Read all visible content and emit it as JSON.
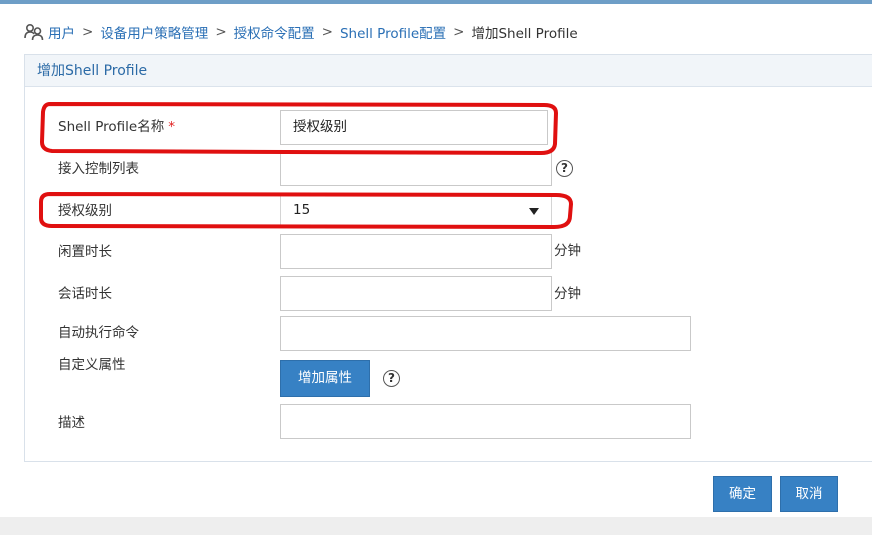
{
  "breadcrumb": {
    "items": [
      "用户",
      "设备用户策略管理",
      "授权命令配置",
      "Shell Profile配置"
    ],
    "current": "增加Shell Profile",
    "separator": ">"
  },
  "panel": {
    "title": "增加Shell Profile"
  },
  "form": {
    "profile_name": {
      "label": "Shell Profile名称",
      "required_mark": "*",
      "value": "授权级别"
    },
    "access_control_list": {
      "label": "接入控制列表",
      "value": "",
      "help": "?"
    },
    "auth_level": {
      "label": "授权级别",
      "value": "15"
    },
    "idle_time": {
      "label": "闲置时长",
      "value": "",
      "unit": "分钟"
    },
    "session_time": {
      "label": "会话时长",
      "value": "",
      "unit": "分钟"
    },
    "auto_command": {
      "label": "自动执行命令",
      "value": ""
    },
    "custom_attr": {
      "label": "自定义属性",
      "add_button": "增加属性",
      "help": "?"
    },
    "description": {
      "label": "描述",
      "value": ""
    }
  },
  "actions": {
    "confirm": "确定",
    "cancel": "取消"
  },
  "colors": {
    "accent": "#3781c4",
    "link": "#2a6fb5",
    "required": "#e02020",
    "annotation": "#e01010"
  },
  "icons": {
    "breadcrumb": "users-icon",
    "help": "help-circle-icon",
    "dropdown": "caret-down-icon"
  }
}
